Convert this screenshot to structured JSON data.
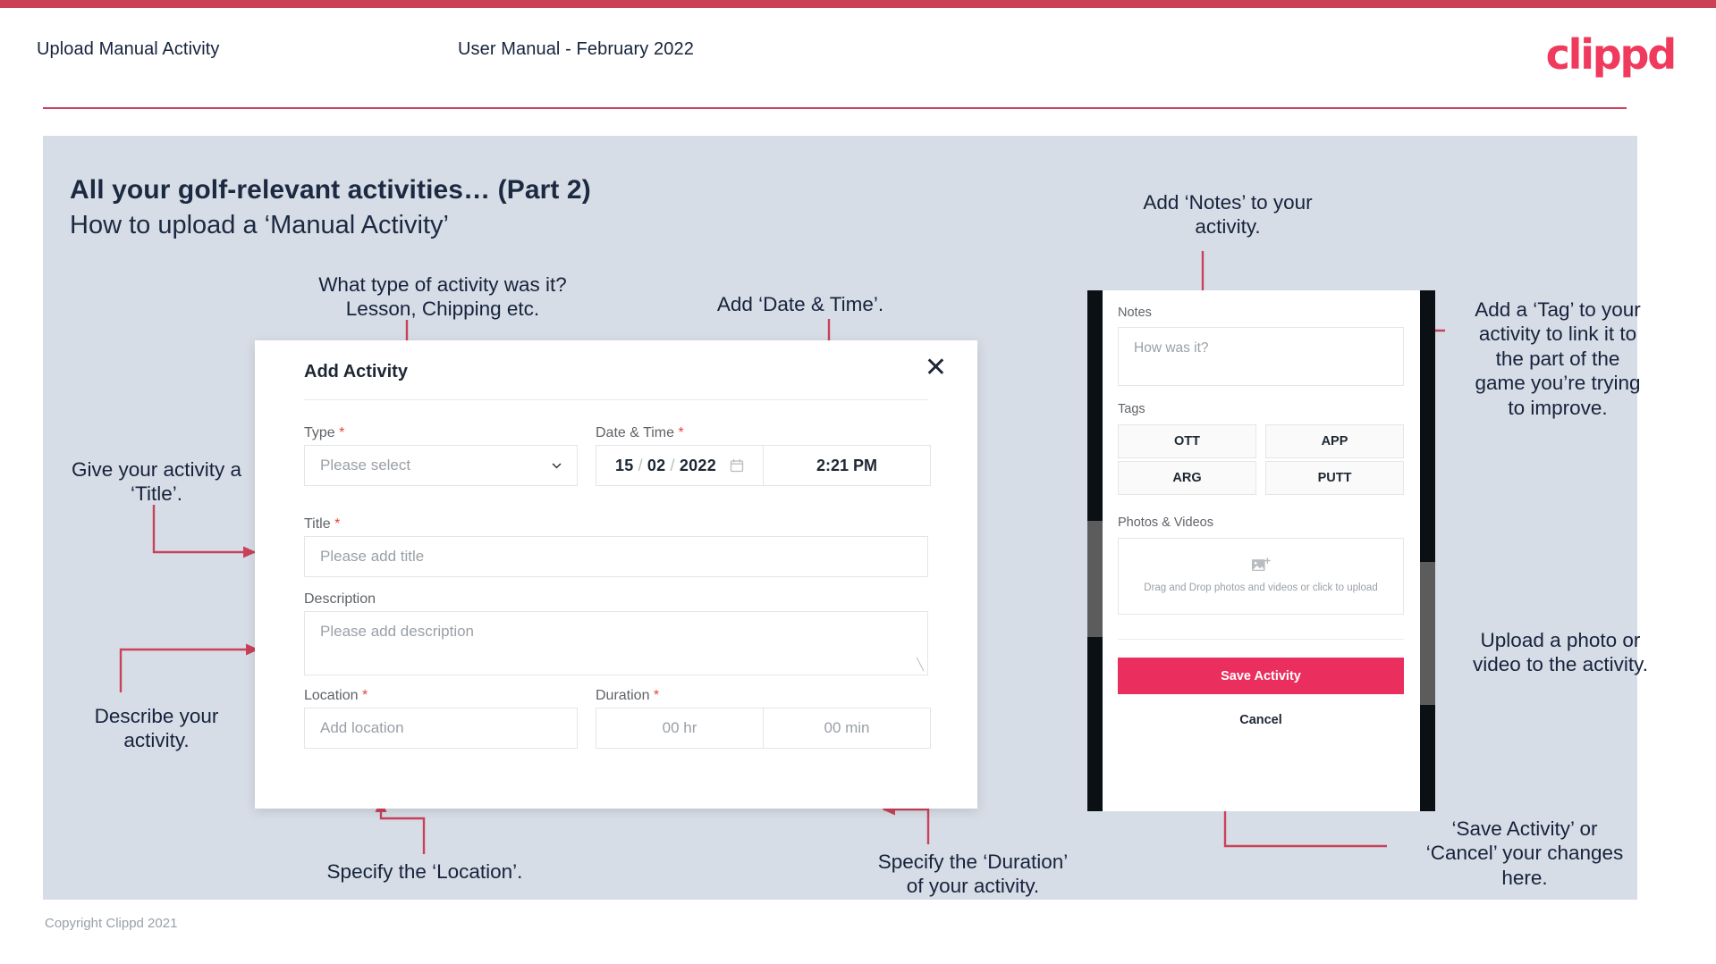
{
  "header": {
    "title": "Upload Manual Activity",
    "subtitle": "User Manual - February 2022",
    "logo": "clippd"
  },
  "slide": {
    "title": "All your golf-relevant activities… (Part 2)",
    "subtitle": "How to upload a ‘Manual Activity’"
  },
  "footer": {
    "copyright": "Copyright Clippd 2021"
  },
  "annotations": {
    "type": "What type of activity was it?\nLesson, Chipping etc.",
    "datetime": "Add ‘Date & Time’.",
    "title": "Give your activity a\n‘Title’.",
    "description": "Describe your\nactivity.",
    "location": "Specify the ‘Location’.",
    "duration": "Specify the ‘Duration’\nof your activity.",
    "notes": "Add ‘Notes’ to your\nactivity.",
    "tags": "Add a ‘Tag’ to your\nactivity to link it to\nthe part of the\ngame you’re trying\nto improve.",
    "upload": "Upload a photo or\nvideo to the activity.",
    "save": "‘Save Activity’ or\n‘Cancel’ your changes\nhere."
  },
  "modal": {
    "title": "Add Activity",
    "close_icon": "close-icon",
    "fields": {
      "type_label": "Type",
      "type_placeholder": "Please select",
      "datetime_label": "Date & Time",
      "date_day": "15",
      "date_month": "02",
      "date_year": "2022",
      "time_value": "2:21 PM",
      "title_label": "Title",
      "title_placeholder": "Please add title",
      "description_label": "Description",
      "description_placeholder": "Please add description",
      "location_label": "Location",
      "location_placeholder": "Add location",
      "duration_label": "Duration",
      "duration_hours": "00 hr",
      "duration_minutes": "00 min"
    }
  },
  "phone": {
    "notes_label": "Notes",
    "notes_placeholder": "How was it?",
    "tags_label": "Tags",
    "tags": [
      "OTT",
      "APP",
      "ARG",
      "PUTT"
    ],
    "photos_label": "Photos & Videos",
    "dropzone_text": "Drag and Drop photos and videos or\nclick to upload",
    "save_label": "Save Activity",
    "cancel_label": "Cancel"
  },
  "colors": {
    "brand_pink": "#ea2f5e",
    "accent_rule": "#c9415a",
    "slide_bg": "#d7dde6",
    "text_dark": "#16233c",
    "arrow": "#c9415a"
  }
}
